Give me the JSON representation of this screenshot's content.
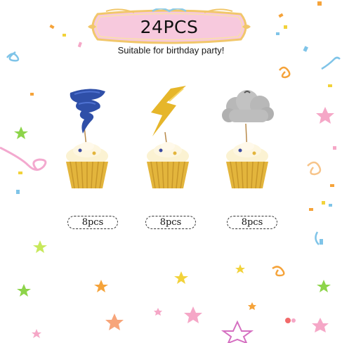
{
  "banner": {
    "title": "24PCS",
    "subtitle": "Suitable for birthday party!"
  },
  "products": [
    {
      "name": "tornado",
      "color": "#2f4fa8",
      "quantity_label": "8pcs"
    },
    {
      "name": "lightning",
      "color": "#e6b62a",
      "quantity_label": "8pcs"
    },
    {
      "name": "cloud",
      "color": "#b8b8b8",
      "quantity_label": "8pcs"
    }
  ],
  "colors": {
    "banner_fill": "#f7c9dd",
    "banner_frame": "#f1c76b",
    "cupcake_liner": "#e3b53c",
    "frosting": "#fbf2d2"
  }
}
